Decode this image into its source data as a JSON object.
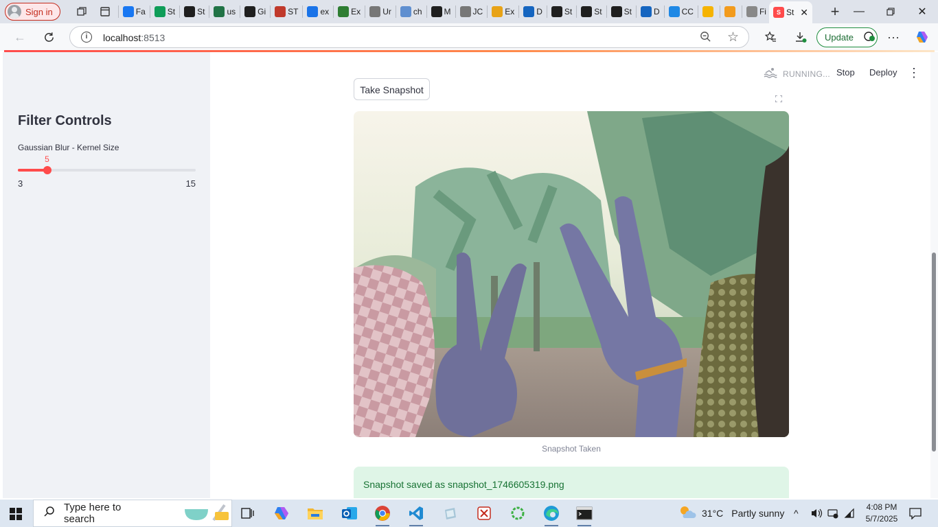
{
  "browser": {
    "signin_label": "Sign in",
    "tabs": [
      {
        "name": "facebook",
        "label": "Fa",
        "icon": "facebook-icon",
        "color": "#1877f2"
      },
      {
        "name": "streamlit-green",
        "label": "St",
        "icon": "plus-icon",
        "color": "#0f9d58"
      },
      {
        "name": "github-1",
        "label": "St",
        "icon": "github-icon",
        "color": "#1f1f1f"
      },
      {
        "name": "excel",
        "label": "us",
        "icon": "excel-icon",
        "color": "#217346"
      },
      {
        "name": "github-2",
        "label": "Gi",
        "icon": "github-icon",
        "color": "#1f1f1f"
      },
      {
        "name": "pdf",
        "label": "ST",
        "icon": "pdf-icon",
        "color": "#c0392b"
      },
      {
        "name": "search-1",
        "label": "ex",
        "icon": "search-icon",
        "color": "#1a73e8"
      },
      {
        "name": "sheet",
        "label": "Ex",
        "icon": "sheet-icon",
        "color": "#2e7d32"
      },
      {
        "name": "globe-1",
        "label": "Ur",
        "icon": "globe-icon",
        "color": "#777777"
      },
      {
        "name": "search-2",
        "label": "ch",
        "icon": "search-icon",
        "color": "#5f8fd0"
      },
      {
        "name": "openai",
        "label": "M",
        "icon": "openai-icon",
        "color": "#1f1f1f"
      },
      {
        "name": "globe-2",
        "label": "JC",
        "icon": "globe-icon",
        "color": "#777777"
      },
      {
        "name": "folder",
        "label": "Ex",
        "icon": "folder-icon",
        "color": "#e8a317"
      },
      {
        "name": "dashboard-1",
        "label": "D",
        "icon": "grid-icon",
        "color": "#1565c0"
      },
      {
        "name": "crown-1",
        "label": "St",
        "icon": "crown-icon",
        "color": "#1f1f1f"
      },
      {
        "name": "crown-2",
        "label": "St",
        "icon": "crown-icon",
        "color": "#1f1f1f"
      },
      {
        "name": "crown-3",
        "label": "St",
        "icon": "crown-icon",
        "color": "#1f1f1f"
      },
      {
        "name": "dashboard-2",
        "label": "D",
        "icon": "grid-icon",
        "color": "#1565c0"
      },
      {
        "name": "copilot",
        "label": "CC",
        "icon": "copilot-icon",
        "color": "#1e88e5"
      },
      {
        "name": "emoji",
        "label": "",
        "icon": "emoji-icon",
        "color": "#f5b301"
      },
      {
        "name": "notebook",
        "label": "",
        "icon": "notebook-icon",
        "color": "#f29b1d"
      },
      {
        "name": "settings",
        "label": "Fi",
        "icon": "gear-icon",
        "color": "#888888"
      }
    ],
    "active_tab_label": "St",
    "url_host": "localhost",
    "url_port": ":8513",
    "update_label": "Update"
  },
  "app": {
    "sidebar_title": "Filter Controls",
    "slider_label": "Gaussian Blur - Kernel Size",
    "slider_value": "5",
    "slider_min": "3",
    "slider_max": "15",
    "slider_fraction": 0.1667,
    "status_label": "RUNNING...",
    "stop_label": "Stop",
    "deploy_label": "Deploy",
    "snapshot_button": "Take Snapshot",
    "image_caption": "Snapshot Taken",
    "success_message": "Snapshot saved as snapshot_1746605319.png"
  },
  "taskbar": {
    "search_placeholder": "Type here to search",
    "weather_temp": "31°C",
    "weather_desc": "Partly sunny",
    "time": "4:08 PM",
    "date": "5/7/2025"
  },
  "colors": {
    "accent": "#ff4b4b",
    "sidebar_bg": "#f0f2f6",
    "success_bg": "#dff5e7",
    "success_text": "#177233"
  }
}
